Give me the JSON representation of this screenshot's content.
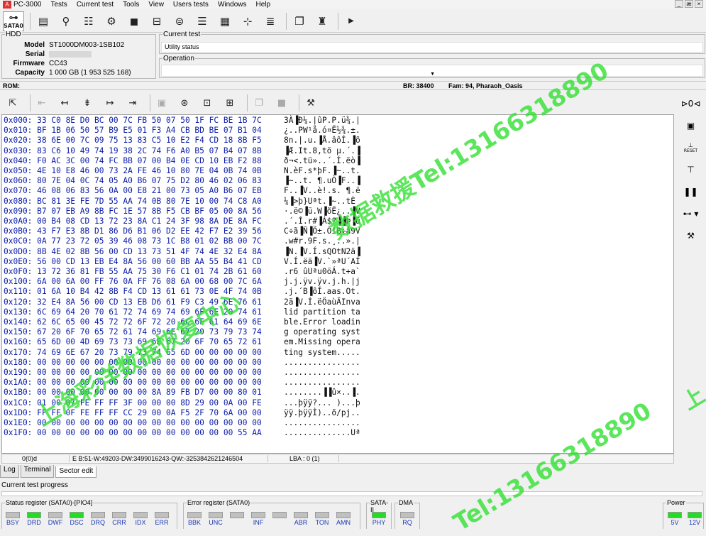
{
  "menu": {
    "app_name": "PC-3000",
    "items": [
      "Tests",
      "Current test",
      "Tools",
      "View",
      "Users tests",
      "Windows",
      "Help"
    ],
    "window_buttons": [
      "_",
      "æ",
      "×"
    ]
  },
  "toolbar": {
    "sata_label": "SATA0"
  },
  "hdd": {
    "legend": "HDD",
    "labels": {
      "model": "Model",
      "serial": "Serial",
      "firmware": "Firmware",
      "capacity": "Capacity"
    },
    "model": "ST1000DM003-1SB102",
    "serial": "",
    "firmware": "CC43",
    "capacity": "1 000 GB (1 953 525 168)"
  },
  "current_test": {
    "legend": "Current test",
    "value": "Utility status"
  },
  "operation": {
    "legend": "Operation",
    "value": ""
  },
  "rombar": {
    "rom": "ROM:",
    "br": "BR: 38400",
    "fam": "Fam: 94, Pharaoh_Oasis"
  },
  "hex": {
    "rows": [
      {
        "addr": "0x000:",
        "bytes": "33 C0 8E D0 BC 00 7C FB 50 07 50 1F FC BE 1B 7C",
        "ascii": "3À▐Ð¼.|ûP.P.ü¾.|"
      },
      {
        "addr": "0x010:",
        "bytes": "BF 1B 06 50 57 B9 E5 01 F3 A4 CB BD BE 07 B1 04",
        "ascii": "¿..PW¹å.ó¤Ë½¾.±."
      },
      {
        "addr": "0x020:",
        "bytes": "38 6E 00 7C 09 75 13 83 C5 10 E2 F4 CD 18 8B F5",
        "ascii": "8n.|.u.▐Å.âôÍ.▐õ"
      },
      {
        "addr": "0x030:",
        "bytes": "83 C6 10 49 74 19 38 2C 74 F6 A0 B5 07 B4 07 8B",
        "ascii": "▐Æ.It.8,tö µ.´.▐"
      },
      {
        "addr": "0x040:",
        "bytes": "F0 AC 3C 00 74 FC BB 07 00 B4 0E CD 10 EB F2 88",
        "ascii": "ð¬<.tü»..´.Í.ëò▐"
      },
      {
        "addr": "0x050:",
        "bytes": "4E 10 E8 46 00 73 2A FE 46 10 80 7E 04 0B 74 0B",
        "ascii": "N.èF.s*þF.▐~..t."
      },
      {
        "addr": "0x060:",
        "bytes": "80 7E 04 0C 74 05 A0 B6 07 75 D2 80 46 02 06 83",
        "ascii": "▐~..t. ¶.uÒ▐F..▐"
      },
      {
        "addr": "0x070:",
        "bytes": "46 08 06 83 56 0A 00 E8 21 00 73 05 A0 B6 07 EB",
        "ascii": "F..▐V..è!.s. ¶.ë"
      },
      {
        "addr": "0x080:",
        "bytes": "BC 81 3E FE 7D 55 AA 74 0B 80 7E 10 00 74 C8 A0",
        "ascii": "¼▐>þ}Uªt.▐~..tÈ "
      },
      {
        "addr": "0x090:",
        "bytes": "B7 07 EB A9 8B FC 1E 57 8B F5 CB BF 05 00 8A 56",
        "ascii": "·.ë©▐ü.W▐õË¿..▐V"
      },
      {
        "addr": "0x0A0:",
        "bytes": "00 B4 08 CD 13 72 23 8A C1 24 3F 98 8A DE 8A FC",
        "ascii": ".´.Í.r#▐Á$?▐▐Þ▐ü"
      },
      {
        "addr": "0x0B0:",
        "bytes": "43 F7 E3 8B D1 86 D6 B1 06 D2 EE 42 F7 E2 39 56",
        "ascii": "C÷ã▐Ñ▐Ö±.ÒîB÷â9V"
      },
      {
        "addr": "0x0C0:",
        "bytes": "0A 77 23 72 05 39 46 08 73 1C B8 01 02 BB 00 7C",
        "ascii": ".w#r.9F.s.¸..».|"
      },
      {
        "addr": "0x0D0:",
        "bytes": "8B 4E 02 8B 56 00 CD 13 73 51 4F 74 4E 32 E4 8A",
        "ascii": "▐N.▐V.Í.sQOtN2ä▐"
      },
      {
        "addr": "0x0E0:",
        "bytes": "56 00 CD 13 EB E4 8A 56 00 60 BB AA 55 B4 41 CD",
        "ascii": "V.Í.ëä▐V.`»ªU´AÍ"
      },
      {
        "addr": "0x0F0:",
        "bytes": "13 72 36 81 FB 55 AA 75 30 F6 C1 01 74 2B 61 60",
        "ascii": ".r6 ûUªu0öÁ.t+a`"
      },
      {
        "addr": "0x100:",
        "bytes": "6A 00 6A 00 FF 76 0A FF 76 08 6A 00 68 00 7C 6A",
        "ascii": "j.j.ÿv.ÿv.j.h.|j"
      },
      {
        "addr": "0x110:",
        "bytes": "01 6A 10 B4 42 8B F4 CD 13 61 61 73 0E 4F 74 0B",
        "ascii": ".j.´B▐ôÍ.aas.Ot."
      },
      {
        "addr": "0x120:",
        "bytes": "32 E4 8A 56 00 CD 13 EB D6 61 F9 C3 49 6E 76 61",
        "ascii": "2ä▐V.Í.ëÖaùÃInva"
      },
      {
        "addr": "0x130:",
        "bytes": "6C 69 64 20 70 61 72 74 69 74 69 6F 6E 20 74 61",
        "ascii": "lid partition ta"
      },
      {
        "addr": "0x140:",
        "bytes": "62 6C 65 00 45 72 72 6F 72 20 6C 6F 61 64 69 6E",
        "ascii": "ble.Error loadin"
      },
      {
        "addr": "0x150:",
        "bytes": "67 20 6F 70 65 72 61 74 69 6E 67 20 73 79 73 74",
        "ascii": "g operating syst"
      },
      {
        "addr": "0x160:",
        "bytes": "65 6D 00 4D 69 73 73 69 6E 67 20 6F 70 65 72 61",
        "ascii": "em.Missing opera"
      },
      {
        "addr": "0x170:",
        "bytes": "74 69 6E 67 20 73 79 73 74 65 6D 00 00 00 00 00",
        "ascii": "ting system....."
      },
      {
        "addr": "0x180:",
        "bytes": "00 00 00 00 00 00 00 00 00 00 00 00 00 00 00 00",
        "ascii": "................"
      },
      {
        "addr": "0x190:",
        "bytes": "00 00 00 00 00 00 00 00 00 00 00 00 00 00 00 00",
        "ascii": "................"
      },
      {
        "addr": "0x1A0:",
        "bytes": "00 00 00 00 00 00 00 00 00 00 00 00 00 00 00 00",
        "ascii": "................"
      },
      {
        "addr": "0x1B0:",
        "bytes": "00 00 00 00 00 00 00 00 8A 89 FB D7 00 00 80 01",
        "ascii": "........▐▐û×..▐."
      },
      {
        "addr": "0x1C0:",
        "bytes": "01 00 07 FE FF FF 3F 00 00 00 8D 29 00 0A 00 FE",
        "ascii": "...þÿÿ?... )...þ"
      },
      {
        "addr": "0x1D0:",
        "bytes": "FF FF 0F FE FF FF CC 29 00 0A F5 2F 70 6A 00 00",
        "ascii": "ÿÿ.þÿÿÌ)..õ/pj.."
      },
      {
        "addr": "0x1E0:",
        "bytes": "00 00 00 00 00 00 00 00 00 00 00 00 00 00 00 00",
        "ascii": "................"
      },
      {
        "addr": "0x1F0:",
        "bytes": "00 00 00 00 00 00 00 00 00 00 00 00 00 00 55 AA",
        "ascii": "..............Uª"
      }
    ]
  },
  "statusline": {
    "pos": "0(0)d",
    "info": "E B:51-W:49203-DW:3499016243-QW:-3253842621246504",
    "lba": "LBA : 0 (1)"
  },
  "tabs": [
    "Log",
    "Terminal",
    "Sector edit"
  ],
  "progress": {
    "label": "Current test progress",
    "value": 0
  },
  "status_register": {
    "legend": "Status register (SATA0)-[PIO4]",
    "bits": [
      {
        "label": "BSY",
        "on": false
      },
      {
        "label": "DRD",
        "on": true
      },
      {
        "label": "DWF",
        "on": false
      },
      {
        "label": "DSC",
        "on": true
      },
      {
        "label": "DRQ",
        "on": false
      },
      {
        "label": "CRR",
        "on": false
      },
      {
        "label": "IDX",
        "on": false
      },
      {
        "label": "ERR",
        "on": false
      }
    ]
  },
  "error_register": {
    "legend": "Error register (SATA0)",
    "bits": [
      {
        "label": "BBK",
        "on": false
      },
      {
        "label": "UNC",
        "on": false
      },
      {
        "label": "",
        "on": false
      },
      {
        "label": "INF",
        "on": false
      },
      {
        "label": "",
        "on": false
      },
      {
        "label": "ABR",
        "on": false
      },
      {
        "label": "TON",
        "on": false
      },
      {
        "label": "AMN",
        "on": false
      }
    ]
  },
  "sata2": {
    "legend": "SATA-II",
    "bits": [
      {
        "label": "PHY",
        "on": true
      }
    ]
  },
  "dma": {
    "legend": "DMA",
    "bits": [
      {
        "label": "RQ",
        "on": false
      }
    ]
  },
  "power": {
    "legend": "Power",
    "bits": [
      {
        "label": "5V",
        "on": true
      },
      {
        "label": "12V",
        "on": true
      }
    ]
  },
  "watermark": {
    "text1": "数据救援Tel:13166318890",
    "text2": "上海彩洋数据恢复中心",
    "text3": "Tel:13166318890",
    "text4": "上"
  },
  "colors": {
    "led_on": "#22dd22",
    "led_off": "#c0c0c0",
    "hex_text": "#0a1ca8",
    "watermark": "#2ee02e"
  }
}
